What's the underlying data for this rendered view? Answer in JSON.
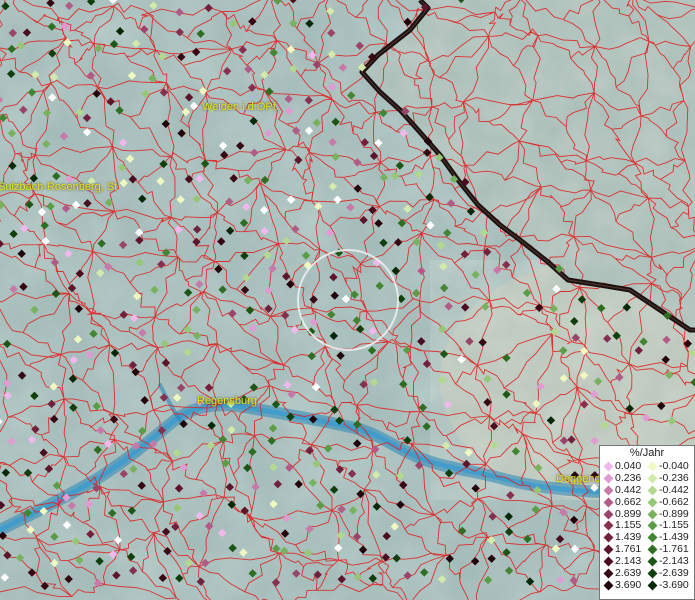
{
  "places": [
    {
      "name": "Weiden i.d.OPf."
    },
    {
      "name": "Sulzbach-Rosenberg, St"
    },
    {
      "name": "Regensburg"
    },
    {
      "name": "Deggend"
    }
  ],
  "legend": {
    "title": "%/Jahr",
    "positive": [
      {
        "label": "0.040",
        "color": "#f0b8ec"
      },
      {
        "label": "0.236",
        "color": "#df9cd3"
      },
      {
        "label": "0.442",
        "color": "#c77aa9"
      },
      {
        "label": "0.662",
        "color": "#b05c87"
      },
      {
        "label": "0.899",
        "color": "#9a4469"
      },
      {
        "label": "1.155",
        "color": "#863050"
      },
      {
        "label": "1.439",
        "color": "#72213c"
      },
      {
        "label": "1.761",
        "color": "#5e152b"
      },
      {
        "label": "2.143",
        "color": "#4a0c1e"
      },
      {
        "label": "2.639",
        "color": "#370613"
      },
      {
        "label": "3.690",
        "color": "#22020a"
      }
    ],
    "negative": [
      {
        "label": "-0.040",
        "color": "#eef8c0"
      },
      {
        "label": "-0.236",
        "color": "#d2ebaa"
      },
      {
        "label": "-0.442",
        "color": "#b3d98f"
      },
      {
        "label": "-0.662",
        "color": "#95c776"
      },
      {
        "label": "-0.899",
        "color": "#78b25e"
      },
      {
        "label": "-1.155",
        "color": "#5c9c46"
      },
      {
        "label": "-1.439",
        "color": "#438532"
      },
      {
        "label": "-1.761",
        "color": "#2e6e22"
      },
      {
        "label": "-2.143",
        "color": "#1d5616"
      },
      {
        "label": "-2.639",
        "color": "#103f0d"
      },
      {
        "label": "-3.690",
        "color": "#062806"
      }
    ]
  },
  "colors": {
    "boundary": "#e02020",
    "border": "#1a1010",
    "river": "#2a86b8",
    "white_marker": "#ffffff"
  }
}
